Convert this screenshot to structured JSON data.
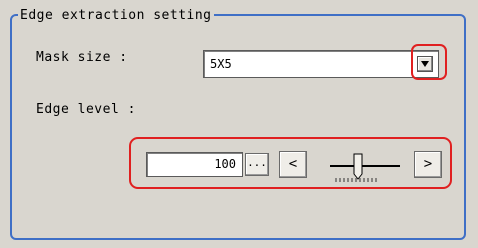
{
  "group": {
    "title": "Edge extraction setting"
  },
  "mask_size": {
    "label": "Mask size :",
    "selected_value": "5X5",
    "dropdown_icon": "triangle-down-icon"
  },
  "edge_level": {
    "label": "Edge level :",
    "value": "100",
    "browse_label": "...",
    "decrement_label": "<",
    "increment_label": ">",
    "slider_level_fraction": 0.4
  },
  "colors": {
    "panel_border": "#3f6fc6",
    "highlight": "#e02020",
    "background": "#d9d6cf"
  }
}
